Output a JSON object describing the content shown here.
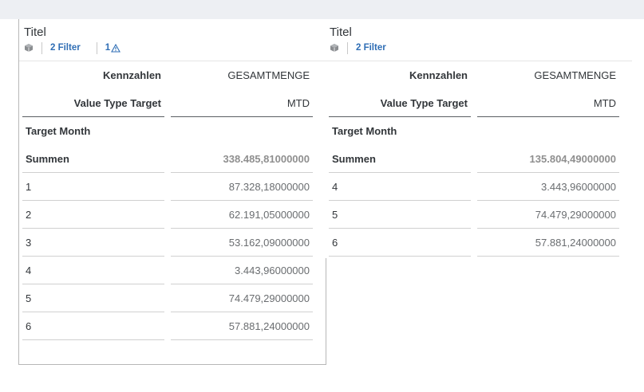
{
  "widgets": [
    {
      "title": "Titel",
      "filter_label": "2 Filter",
      "warning_count": "1",
      "measure_header": "Kennzahlen",
      "measure_value": "GESAMTMENGE",
      "vt_label": "Value Type Target",
      "vt_value": "MTD",
      "dim_label": "Target Month",
      "sum_label": "Summen",
      "sum_value": "338.485,81000000",
      "rows": [
        {
          "month": "1",
          "value": "87.328,18000000"
        },
        {
          "month": "2",
          "value": "62.191,05000000"
        },
        {
          "month": "3",
          "value": "53.162,09000000"
        },
        {
          "month": "4",
          "value": "3.443,96000000"
        },
        {
          "month": "5",
          "value": "74.479,29000000"
        },
        {
          "month": "6",
          "value": "57.881,24000000"
        }
      ]
    },
    {
      "title": "Titel",
      "filter_label": "2 Filter",
      "measure_header": "Kennzahlen",
      "measure_value": "GESAMTMENGE",
      "vt_label": "Value Type Target",
      "vt_value": "MTD",
      "dim_label": "Target Month",
      "sum_label": "Summen",
      "sum_value": "135.804,49000000",
      "rows": [
        {
          "month": "4",
          "value": "3.443,96000000"
        },
        {
          "month": "5",
          "value": "74.479,29000000"
        },
        {
          "month": "6",
          "value": "57.881,24000000"
        }
      ]
    }
  ]
}
